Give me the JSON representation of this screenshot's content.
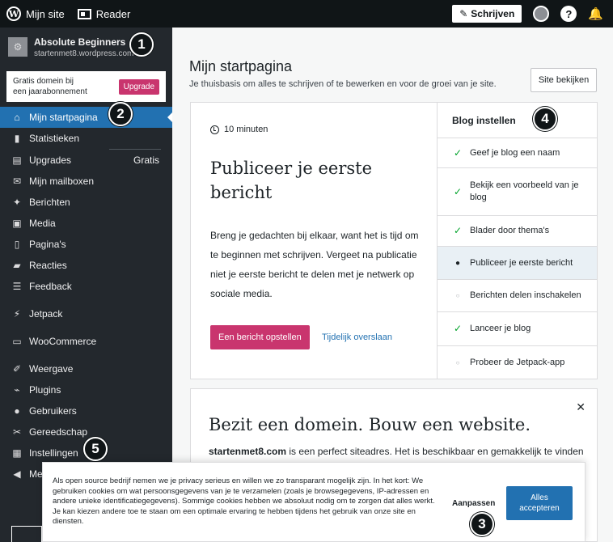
{
  "topbar": {
    "my_site": "Mijn site",
    "reader": "Reader",
    "write": "Schrijven"
  },
  "sidebar": {
    "site_name": "Absolute Beginners",
    "site_url": "startenmet8.wordpress.com",
    "upgrade_text_1": "Gratis domein bij",
    "upgrade_text_2": "een jaarabonnement",
    "upgrade_button": "Upgrade",
    "items": [
      {
        "label": "Mijn startpagina",
        "icon": "home-icon"
      },
      {
        "label": "Statistieken",
        "icon": "stats-icon"
      },
      {
        "label": "Upgrades",
        "icon": "upgrades-icon",
        "badge": "Gratis"
      },
      {
        "label": "Mijn mailboxen",
        "icon": "mail-icon"
      },
      {
        "label": "Berichten",
        "icon": "pin-icon"
      },
      {
        "label": "Media",
        "icon": "media-icon"
      },
      {
        "label": "Pagina's",
        "icon": "pages-icon"
      },
      {
        "label": "Reacties",
        "icon": "comments-icon"
      },
      {
        "label": "Feedback",
        "icon": "feedback-icon"
      },
      {
        "label": "Jetpack",
        "icon": "jetpack-icon"
      },
      {
        "label": "WooCommerce",
        "icon": "woo-icon"
      },
      {
        "label": "Weergave",
        "icon": "brush-icon"
      },
      {
        "label": "Plugins",
        "icon": "plugin-icon"
      },
      {
        "label": "Gebruikers",
        "icon": "users-icon"
      },
      {
        "label": "Gereedschap",
        "icon": "tools-icon"
      },
      {
        "label": "Instellingen",
        "icon": "settings-icon"
      },
      {
        "label": "Me",
        "icon": "collapse-icon"
      }
    ]
  },
  "callouts": [
    "1",
    "2",
    "3",
    "4",
    "5"
  ],
  "main": {
    "title": "Mijn startpagina",
    "subtitle": "Je thuisbasis om alles te schrijven of te bewerken en voor de groei van je site.",
    "view_site": "Site bekijken"
  },
  "task_card": {
    "duration": "10 minuten",
    "title": "Publiceer je eerste bericht",
    "description": "Breng je gedachten bij elkaar, want het is tijd om te beginnen met schrijven. Vergeet na publicatie niet je eerste bericht te delen met je netwerk op sociale media.",
    "primary_button": "Een bericht opstellen",
    "skip_link": "Tijdelijk overslaan"
  },
  "checklist": {
    "title": "Blog instellen",
    "steps": [
      {
        "label": "Geef je blog een naam",
        "state": "done"
      },
      {
        "label": "Bekijk een voorbeeld van je blog",
        "state": "done"
      },
      {
        "label": "Blader door thema's",
        "state": "done"
      },
      {
        "label": "Publiceer je eerste bericht",
        "state": "current"
      },
      {
        "label": "Berichten delen inschakelen",
        "state": "todo"
      },
      {
        "label": "Lanceer je blog",
        "state": "done"
      },
      {
        "label": "Probeer de Jetpack-app",
        "state": "todo"
      }
    ]
  },
  "domain_card": {
    "title": "Bezit een domein. Bouw een website.",
    "domain": "startenmet8.com",
    "text_rest": " is een perfect siteadres. Het is beschikbaar en gemakkelijk te vinden en te volgen. Koop het nu en claim een je eigen plek op het internet."
  },
  "cookie": {
    "text": "Als open source bedrijf nemen we je privacy serieus en willen we zo transparant mogelijk zijn. In het kort: We gebruiken cookies om wat persoonsgegevens van je te verzamelen (zoals je browsegegevens, IP-adressen en andere unieke identificatiegegevens). Sommige cookies hebben we absoluut nodig om te zorgen dat alles werkt. Je kan kiezen andere toe te staan om een optimale ervaring te hebben tijdens het gebruik van onze site en diensten.",
    "customize": "Aanpassen",
    "accept_1": "Alles",
    "accept_2": "accepteren"
  },
  "colors": {
    "accent_pink": "#c9356e",
    "accent_blue": "#2271b1",
    "sidebar_bg": "#23282d",
    "topbar_bg": "#101517",
    "check_green": "#00a32a"
  }
}
